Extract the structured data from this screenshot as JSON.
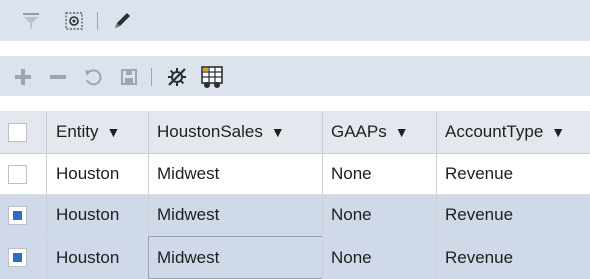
{
  "toolbar_top": {
    "icons": [
      "filter-icon",
      "chooser-icon",
      "edit-pencil-icon"
    ]
  },
  "toolbar_grid": {
    "icons": [
      "add-icon",
      "remove-icon",
      "undo-icon",
      "save-icon",
      "clear-filter-icon",
      "grid-settings-icon"
    ]
  },
  "colors": {
    "toolbar_bg": "#dde3ec",
    "header_bg": "#e4e8ee",
    "selected_row_bg": "#cfd9e8",
    "checkbox_accent": "#2f6dc0"
  },
  "table": {
    "columns": [
      {
        "label": "Entity"
      },
      {
        "label": "HoustonSales"
      },
      {
        "label": "GAAPs"
      },
      {
        "label": "AccountType"
      }
    ],
    "rows": [
      {
        "checked": false,
        "cells": [
          "Houston",
          "Midwest",
          "None",
          "Revenue"
        ]
      },
      {
        "checked": true,
        "cells": [
          "Houston",
          "Midwest",
          "None",
          "Revenue"
        ]
      },
      {
        "checked": true,
        "cells": [
          "Houston",
          "Midwest",
          "None",
          "Revenue"
        ]
      }
    ]
  }
}
